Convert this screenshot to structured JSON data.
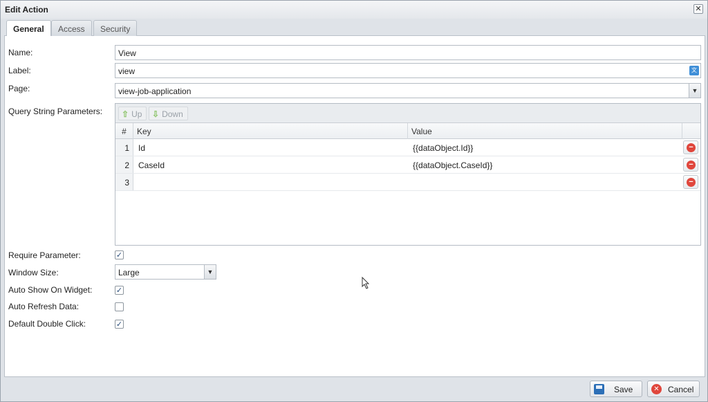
{
  "window": {
    "title": "Edit Action",
    "close": "✕"
  },
  "tabs": [
    {
      "label": "General"
    },
    {
      "label": "Access"
    },
    {
      "label": "Security"
    }
  ],
  "form": {
    "name": {
      "label": "Name:",
      "value": "View"
    },
    "label": {
      "label": "Label:",
      "value": "view"
    },
    "page": {
      "label": "Page:",
      "value": "view-job-application"
    },
    "query": {
      "label": "Query String Parameters:",
      "toolbar": {
        "up": "Up",
        "down": "Down"
      },
      "columns": {
        "num": "#",
        "key": "Key",
        "value": "Value"
      },
      "rows": [
        {
          "num": "1",
          "key": "Id",
          "value": "{{dataObject.Id}}"
        },
        {
          "num": "2",
          "key": "CaseId",
          "value": "{{dataObject.CaseId}}"
        },
        {
          "num": "3",
          "key": "",
          "value": ""
        }
      ]
    },
    "require_parameter": {
      "label": "Require Parameter:",
      "checked": true
    },
    "window_size": {
      "label": "Window Size:",
      "value": "Large"
    },
    "auto_show": {
      "label": "Auto Show On Widget:",
      "checked": true
    },
    "auto_refresh": {
      "label": "Auto Refresh Data:",
      "checked": false
    },
    "default_double_click": {
      "label": "Default Double Click:",
      "checked": true
    }
  },
  "footer": {
    "save": "Save",
    "cancel": "Cancel"
  },
  "icons": {
    "up": "arrow-up-icon",
    "down": "arrow-down-icon",
    "delete": "remove-icon",
    "save": "floppy-icon",
    "cancel": "cancel-icon",
    "translate": "translate-icon"
  },
  "colors": {
    "accent": "#2c6fb7",
    "danger": "#e0463c",
    "arrow": "#8cc46a"
  }
}
